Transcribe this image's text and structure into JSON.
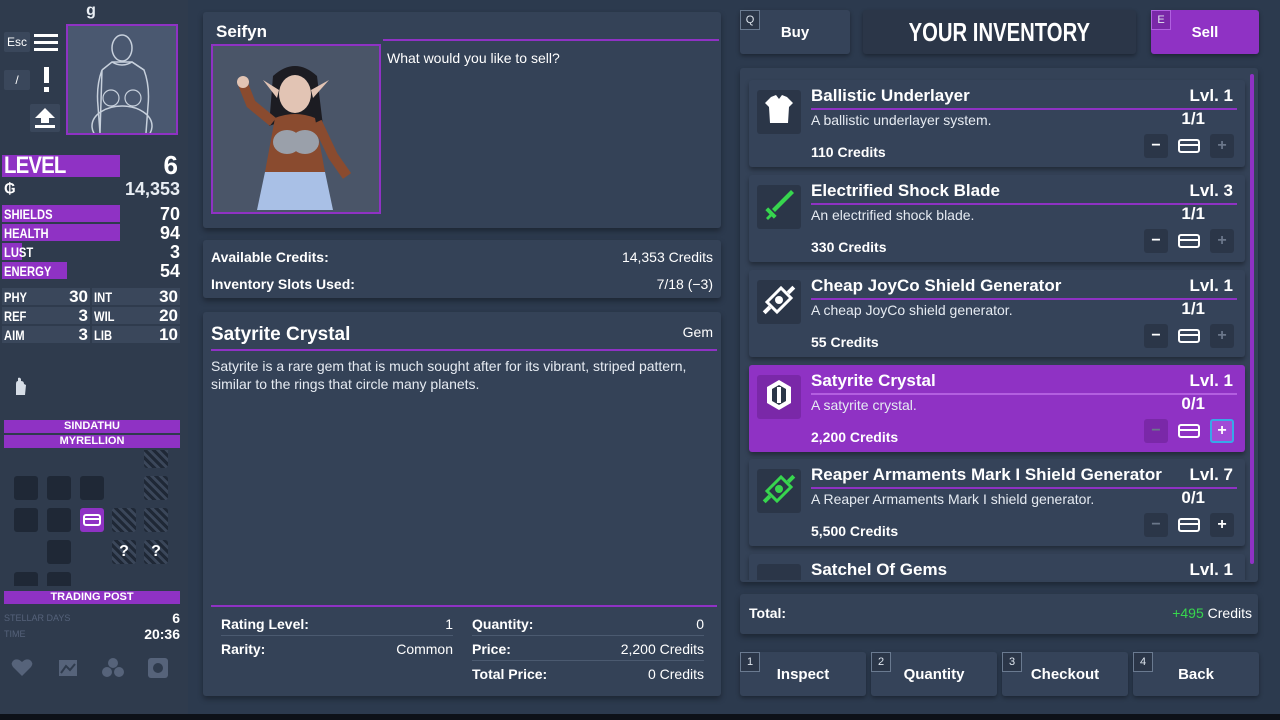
{
  "player": {
    "name": "g",
    "esc_label": "Esc",
    "slash_label": "/",
    "level_label": "LEVEL",
    "level": "6",
    "credits_icon": "credits-glyph",
    "credits": "14,353",
    "stats": [
      {
        "label": "SHIELDS",
        "value": "70",
        "fill": 1.0
      },
      {
        "label": "HEALTH",
        "value": "94",
        "fill": 1.0
      },
      {
        "label": "LUST",
        "value": "3",
        "fill": 0.17
      },
      {
        "label": "ENERGY",
        "value": "54",
        "fill": 0.55
      }
    ],
    "attributes": [
      {
        "label": "PHY",
        "value": "30"
      },
      {
        "label": "INT",
        "value": "30"
      },
      {
        "label": "REF",
        "value": "3"
      },
      {
        "label": "WIL",
        "value": "20"
      },
      {
        "label": "AIM",
        "value": "3"
      },
      {
        "label": "LIB",
        "value": "10"
      }
    ]
  },
  "location": {
    "system": "SINDATHU",
    "planet": "MYRELLION",
    "room": "TRADING POST",
    "days_label": "STELLAR DAYS",
    "days": "6",
    "time_label": "TIME",
    "time": "20:36"
  },
  "vendor": {
    "name": "Seifyn",
    "prompt": "What would you like to sell?"
  },
  "account": {
    "credits_label": "Available Credits:",
    "credits_value": "14,353 Credits",
    "slots_label": "Inventory Slots Used:",
    "slots_value": "7/18 (−3)"
  },
  "selected_item": {
    "name": "Satyrite Crystal",
    "type": "Gem",
    "description": "Satyrite is a rare gem that is much sought after for its vibrant, striped pattern, similar to the rings that circle many planets.",
    "rating_label": "Rating Level:",
    "rating": "1",
    "rarity_label": "Rarity:",
    "rarity": "Common",
    "quantity_label": "Quantity:",
    "quantity": "0",
    "price_label": "Price:",
    "price": "2,200 Credits",
    "total_label": "Total Price:",
    "total": "0 Credits"
  },
  "shop": {
    "title": "YOUR INVENTORY",
    "buy_key": "Q",
    "buy_label": "Buy",
    "sell_key": "E",
    "sell_label": "Sell",
    "items": [
      {
        "name": "Ballistic Underlayer",
        "level": "Lvl. 1",
        "desc": "A ballistic underlayer system.",
        "qty": "1/1",
        "price": "110 Credits",
        "icon": "armor-icon"
      },
      {
        "name": "Electrified Shock Blade",
        "level": "Lvl. 3",
        "desc": "An electrified shock blade.",
        "qty": "1/1",
        "price": "330 Credits",
        "icon": "sword-icon"
      },
      {
        "name": "Cheap JoyCo Shield Generator",
        "level": "Lvl. 1",
        "desc": "A cheap JoyCo shield generator.",
        "qty": "1/1",
        "price": "55 Credits",
        "icon": "shield-generator-icon"
      },
      {
        "name": "Satyrite Crystal",
        "level": "Lvl. 1",
        "desc": "A satyrite crystal.",
        "qty": "0/1",
        "price": "2,200 Credits",
        "icon": "gem-icon"
      },
      {
        "name": "Reaper Armaments Mark I Shield Generator",
        "level": "Lvl. 7",
        "desc": "A Reaper Armaments Mark I shield generator.",
        "qty": "0/1",
        "price": "5,500 Credits",
        "icon": "shield-generator-icon"
      },
      {
        "name": "Satchel Of Gems",
        "level": "Lvl. 1",
        "icon": "gem-pouch-icon"
      }
    ],
    "total_label": "Total:",
    "total_value": "+495",
    "total_unit": "Credits",
    "total_color": "#37d64e"
  },
  "actions": [
    {
      "key": "1",
      "label": "Inspect"
    },
    {
      "key": "2",
      "label": "Quantity"
    },
    {
      "key": "3",
      "label": "Checkout"
    },
    {
      "key": "4",
      "label": "Back"
    }
  ],
  "colors": {
    "accent": "#8f32c4",
    "panel": "#344257",
    "background": "#2c3a4e"
  }
}
